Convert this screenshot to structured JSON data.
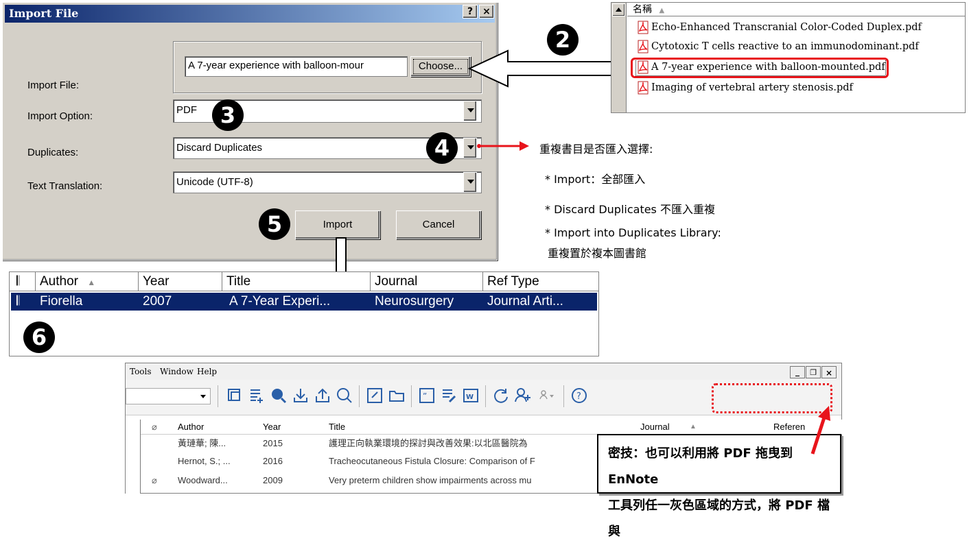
{
  "dialog": {
    "title": "Import File",
    "help_btn": "?",
    "close_btn": "×",
    "import_file_label": "Import File:",
    "import_file_value": "A 7-year experience with balloon-mour",
    "choose_label": "Choose...",
    "import_option_label": "Import Option:",
    "import_option_value": "PDF",
    "duplicates_label": "Duplicates:",
    "duplicates_value": "Discard Duplicates",
    "text_translation_label": "Text Translation:",
    "text_translation_value": "Unicode (UTF-8)",
    "import_button": "Import",
    "cancel_button": "Cancel"
  },
  "steps": {
    "two": "2",
    "three": "3",
    "four": "4",
    "five": "5",
    "six": "6"
  },
  "file_list": {
    "header": "名稱",
    "files": [
      "Echo-Enhanced Transcranial Color-Coded Duplex.pdf",
      "Cytotoxic T cells reactive to an immunodominant.pdf",
      "A 7-year experience with balloon-mounted.pdf",
      "Imaging of vertebral artery stenosis.pdf"
    ]
  },
  "annotation": {
    "heading": "重複書目是否匯入選擇:",
    "line1": "* Import：全部匯入",
    "line2": "* Discard Duplicates 不匯入重複",
    "line3": "* Import into Duplicates Library:",
    "line4": "重複置於複本圖書館"
  },
  "ref_list": {
    "headers": [
      "Author",
      "Year",
      "Title",
      "Journal",
      "Ref Type"
    ],
    "row": [
      "Fiorella",
      "2007",
      "A 7-Year Experi...",
      "Neurosurgery",
      "Journal Arti..."
    ]
  },
  "endnote": {
    "menu": [
      "Tools",
      "Window",
      "Help"
    ],
    "headers": [
      "Author",
      "Year",
      "Title",
      "Journal",
      "Referen"
    ],
    "rows": [
      {
        "author": "黃璉華; 陳...",
        "year": "2015",
        "title": "護理正向執業環境的探討與改善效果:以北區醫院為"
      },
      {
        "author": "Hernot, S.; ...",
        "year": "2016",
        "title": "Tracheocutaneous Fistula Closure: Comparison of F"
      },
      {
        "author": "Woodward...",
        "year": "2009",
        "title": "Very preterm children show impairments across mu"
      }
    ]
  },
  "tip": {
    "line1": "密技：也可以利用將 PDF 拖曳到 EnNote",
    "line2": "工具列任一灰色區域的方式，將 PDF 檔與"
  },
  "colors": {
    "accent_red": "#e8141b",
    "selection": "#0a246a",
    "title_bar": "#0a246a"
  }
}
